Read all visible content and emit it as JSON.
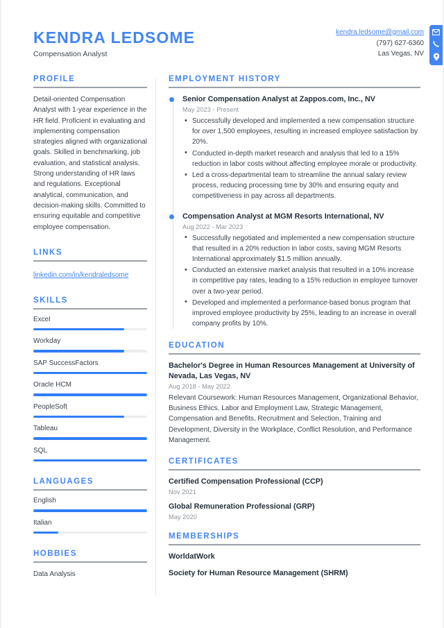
{
  "header": {
    "full_name": "KENDRA LEDSOME",
    "job_title": "Compensation Analyst",
    "email": "kendra.ledsome@gmail.com",
    "phone": "(797) 627-6360",
    "location": "Las Vegas, NV",
    "icons": [
      "envelope-icon",
      "phone-icon",
      "location-pin-icon"
    ],
    "accent_color": "#4285f4"
  },
  "sidebar": {
    "profile": {
      "title": "PROFILE",
      "text": "Detail-oriented Compensation Analyst with 1-year experience in the HR field. Proficient in evaluating and implementing compensation strategies aligned with organizational goals. Skilled in benchmarking, job evaluation, and statistical analysis. Strong understanding of HR laws and regulations. Exceptional analytical, communication, and decision-making skills. Committed to ensuring equitable and competitive employee compensation."
    },
    "links": {
      "title": "LINKS",
      "items": [
        {
          "label": "linkedin.com/in/kendraledsome"
        }
      ]
    },
    "skills": {
      "title": "SKILLS",
      "items": [
        {
          "label": "Excel",
          "level": 80
        },
        {
          "label": "Workday",
          "level": 80
        },
        {
          "label": "SAP SuccessFactors",
          "level": 100
        },
        {
          "label": "Oracle HCM",
          "level": 100
        },
        {
          "label": "PeopleSoft",
          "level": 80
        },
        {
          "label": "Tableau",
          "level": 100
        },
        {
          "label": "SQL",
          "level": 100
        }
      ]
    },
    "languages": {
      "title": "LANGUAGES",
      "items": [
        {
          "label": "English",
          "level": 100
        },
        {
          "label": "Italian",
          "level": 22
        }
      ]
    },
    "hobbies": {
      "title": "HOBBIES",
      "items": [
        {
          "label": "Data Analysis"
        }
      ]
    }
  },
  "main": {
    "employment": {
      "title": "EMPLOYMENT HISTORY",
      "jobs": [
        {
          "title": "Senior Compensation Analyst at Zappos.com, Inc., NV",
          "date": "May 2023 - Present",
          "bullets": [
            "Successfully developed and implemented a new compensation structure for over 1,500 employees, resulting in increased employee satisfaction by 20%.",
            "Conducted in-depth market research and analysis that led to a 15% reduction in labor costs without affecting employee morale or productivity.",
            "Led a cross-departmental team to streamline the annual salary review process, reducing processing time by 30% and ensuring equity and competitiveness in pay across all departments."
          ]
        },
        {
          "title": "Compensation Analyst at MGM Resorts International, NV",
          "date": "Aug 2022 - Mar 2023",
          "bullets": [
            "Successfully negotiated and implemented a new compensation structure that resulted in a 20% reduction in labor costs, saving MGM Resorts International approximately $1.5 million annually.",
            "Conducted an extensive market analysis that resulted in a 10% increase in competitive pay rates, leading to a 15% reduction in employee turnover over a two-year period.",
            "Developed and implemented a performance-based bonus program that improved employee productivity by 25%, leading to an increase in overall company profits by 10%."
          ]
        }
      ]
    },
    "education": {
      "title": "EDUCATION",
      "entries": [
        {
          "title": "Bachelor's Degree in Human Resources Management at University of Nevada, Las Vegas, NV",
          "date": "Aug 2018 - May 2022",
          "description": "Relevant Coursework: Human Resources Management, Organizational Behavior, Business Ethics, Labor and Employment Law, Strategic Management, Compensation and Benefits, Recruitment and Selection, Training and Development, Diversity in the Workplace, Conflict Resolution, and Performance Management."
        }
      ]
    },
    "certificates": {
      "title": "CERTIFICATES",
      "entries": [
        {
          "title": "Certified Compensation Professional (CCP)",
          "date": "Nov 2021"
        },
        {
          "title": "Global Remuneration Professional (GRP)",
          "date": "May 2020"
        }
      ]
    },
    "memberships": {
      "title": "MEMBERSHIPS",
      "entries": [
        {
          "title": "WorldatWork"
        },
        {
          "title": "Society for Human Resource Management (SHRM)"
        }
      ]
    }
  }
}
